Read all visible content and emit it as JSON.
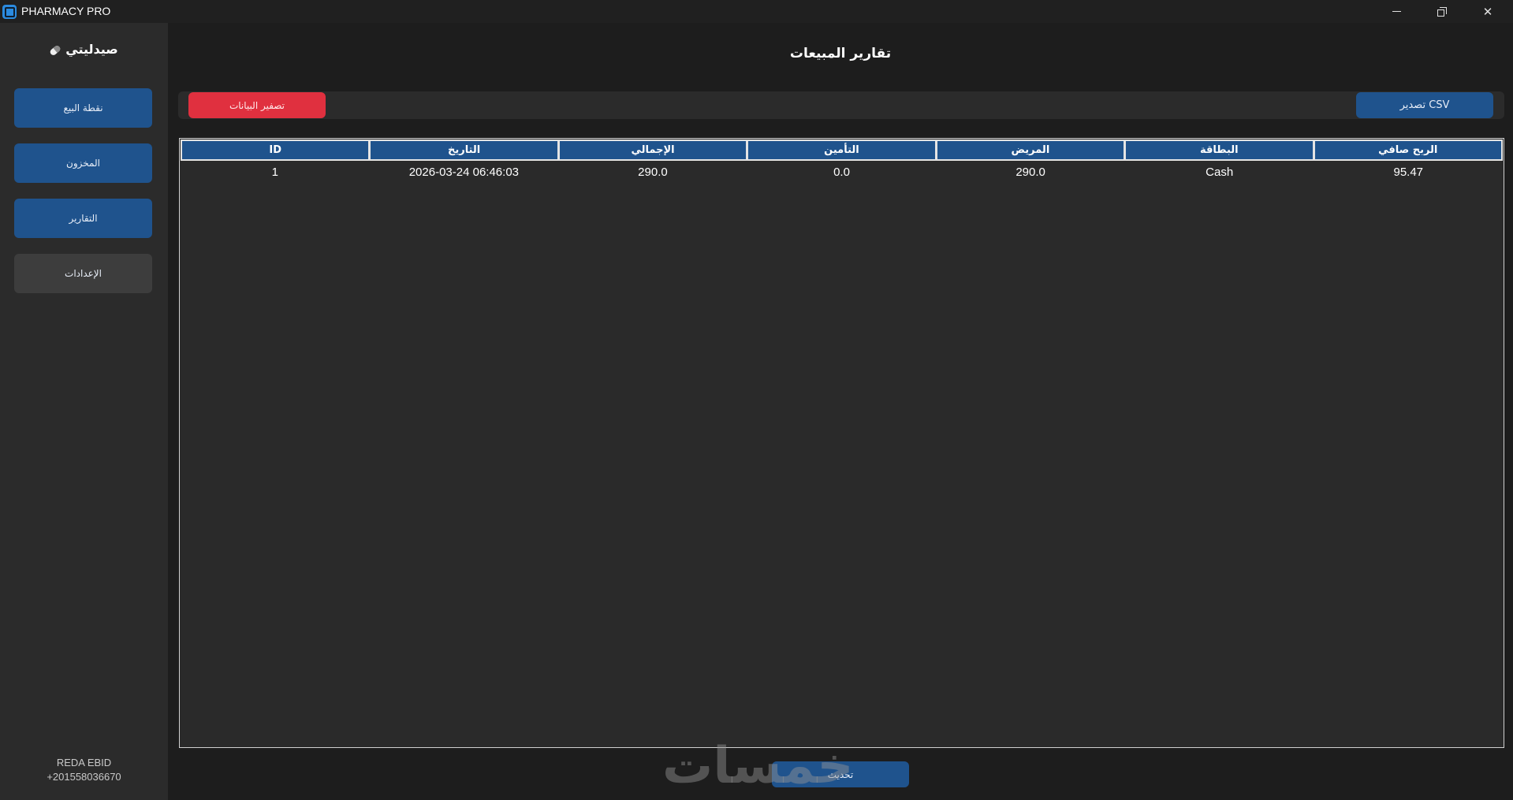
{
  "window": {
    "title": "PHARMACY PRO",
    "controls": {
      "minimize": "minimize-icon",
      "maximize": "restore-icon",
      "close": "close-icon"
    }
  },
  "sidebar": {
    "brand": "صيدليتي",
    "brand_icon": "pill-icon",
    "items": [
      {
        "label": "نقطة البيع",
        "style": "blue"
      },
      {
        "label": "المخزون",
        "style": "blue"
      },
      {
        "label": "التقارير",
        "style": "blue"
      },
      {
        "label": "الإعدادات",
        "style": "gray"
      }
    ],
    "footer": {
      "name": "REDA EBID",
      "phone": "+201558036670"
    }
  },
  "main": {
    "title": "تقارير المبيعات",
    "toolbar": {
      "export_csv": "تصدير CSV",
      "clear_data": "تصفير البيانات"
    },
    "table": {
      "columns": [
        "ID",
        "التاريخ",
        "الإجمالي",
        "التأمين",
        "المريض",
        "البطاقة",
        "الربح صافي"
      ],
      "rows": [
        [
          "1",
          "2026-03-24 06:46:03",
          "290.0",
          "0.0",
          "290.0",
          "Cash",
          "95.47"
        ]
      ]
    },
    "refresh_label": "تحديث",
    "watermark": "خمسات"
  },
  "colors": {
    "accent": "#1f538d",
    "danger": "#e0303f",
    "sidebar_bg": "#2b2b2b",
    "app_bg": "#1d1d1d"
  }
}
